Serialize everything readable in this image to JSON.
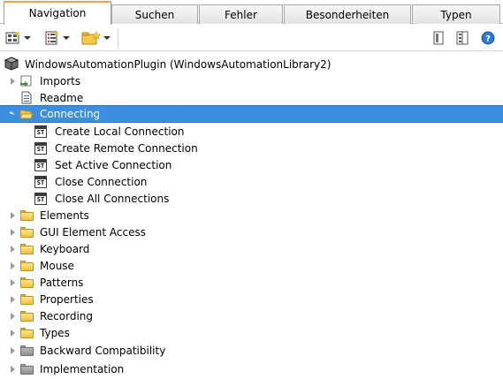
{
  "tabs": [
    {
      "label": "Navigation",
      "active": true
    },
    {
      "label": "Suchen",
      "active": false
    },
    {
      "label": "Fehler",
      "active": false
    },
    {
      "label": "Besonderheiten",
      "active": false
    },
    {
      "label": "Typen",
      "active": false
    }
  ],
  "toolbar": {
    "left_buttons": [
      "tree-view-icon",
      "list-view-icon",
      "new-folder-icon"
    ],
    "right_buttons": [
      "book-icon",
      "collapse-panel-icon",
      "help-icon"
    ]
  },
  "tree": {
    "root": {
      "label": "WindowsAutomationPlugin (WindowsAutomationLibrary2)",
      "icon": "plugin-package-icon"
    },
    "items": [
      {
        "label": "Imports",
        "icon": "imports-icon",
        "expander": "collapsed"
      },
      {
        "label": "Readme",
        "icon": "document-icon",
        "expander": "none"
      },
      {
        "label": "Connecting",
        "icon": "folder-open-icon",
        "expander": "expanded",
        "selected": true
      },
      {
        "label": "Create Local Connection",
        "icon": "st-icon",
        "child": true
      },
      {
        "label": "Create Remote Connection",
        "icon": "st-icon",
        "child": true
      },
      {
        "label": "Set Active Connection",
        "icon": "st-icon",
        "child": true
      },
      {
        "label": "Close Connection",
        "icon": "st-icon",
        "child": true
      },
      {
        "label": "Close All Connections",
        "icon": "st-icon",
        "child": true
      },
      {
        "label": "Elements",
        "icon": "folder-icon",
        "expander": "collapsed"
      },
      {
        "label": "GUI Element Access",
        "icon": "folder-icon",
        "expander": "collapsed"
      },
      {
        "label": "Keyboard",
        "icon": "folder-icon",
        "expander": "collapsed"
      },
      {
        "label": "Mouse",
        "icon": "folder-icon",
        "expander": "collapsed"
      },
      {
        "label": "Patterns",
        "icon": "folder-icon",
        "expander": "collapsed"
      },
      {
        "label": "Properties",
        "icon": "folder-icon",
        "expander": "collapsed"
      },
      {
        "label": "Recording",
        "icon": "folder-icon",
        "expander": "collapsed"
      },
      {
        "label": "Types",
        "icon": "folder-icon",
        "expander": "collapsed"
      },
      {
        "label": "Backward Compatibility",
        "icon": "gray-folder-icon",
        "expander": "collapsed"
      },
      {
        "label": "Implementation",
        "icon": "gray-folder-icon",
        "expander": "collapsed"
      }
    ]
  },
  "colors": {
    "selection": "#3d8ee2",
    "tab_accent": "#f0a63a",
    "folder": "#f3c13c",
    "gray_folder": "#9a9a9a"
  }
}
